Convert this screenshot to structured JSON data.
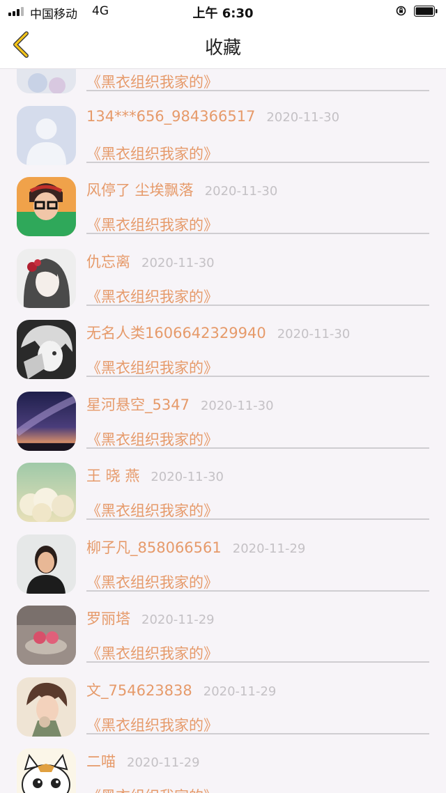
{
  "status_bar": {
    "carrier": "中国移动",
    "network": "4G",
    "time": "上午 6:30"
  },
  "nav": {
    "title": "收藏"
  },
  "items": [
    {
      "name": "",
      "date": "",
      "book": "《黑衣组织我家的》",
      "avatar": "partial-avatar"
    },
    {
      "name": "134***656_984366517",
      "date": "2020-11-30",
      "book": "《黑衣组织我家的》",
      "avatar": "default-avatar"
    },
    {
      "name": "风停了 尘埃飘落",
      "date": "2020-11-30",
      "book": "《黑衣组织我家的》",
      "avatar": "glasses-person-avatar"
    },
    {
      "name": "仇忘离",
      "date": "2020-11-30",
      "book": "《黑衣组织我家的》",
      "avatar": "anime-girl-avatar"
    },
    {
      "name": "无名人类1606642329940",
      "date": "2020-11-30",
      "book": "《黑衣组织我家的》",
      "avatar": "anime-boy-avatar"
    },
    {
      "name": "星河悬空_5347",
      "date": "2020-11-30",
      "book": "《黑衣组织我家的》",
      "avatar": "galaxy-avatar"
    },
    {
      "name": "王 晓 燕",
      "date": "2020-11-30",
      "book": "《黑衣组织我家的》",
      "avatar": "clouds-avatar"
    },
    {
      "name": "柳子凡_858066561",
      "date": "2020-11-29",
      "book": "《黑衣组织我家的》",
      "avatar": "woman-photo-avatar"
    },
    {
      "name": "罗丽塔",
      "date": "2020-11-29",
      "book": "《黑衣组织我家的》",
      "avatar": "roses-avatar"
    },
    {
      "name": "文_754623838",
      "date": "2020-11-29",
      "book": "《黑衣组织我家的》",
      "avatar": "anime-man-avatar"
    },
    {
      "name": "二喵",
      "date": "2020-11-29",
      "book": "《黑衣组织我家的》",
      "avatar": "cartoon-cat-avatar"
    }
  ],
  "colors": {
    "accent": "#e69a6a",
    "date": "#c4c1c5",
    "background": "#f7f4f8",
    "back_arrow": "#f5c518"
  }
}
